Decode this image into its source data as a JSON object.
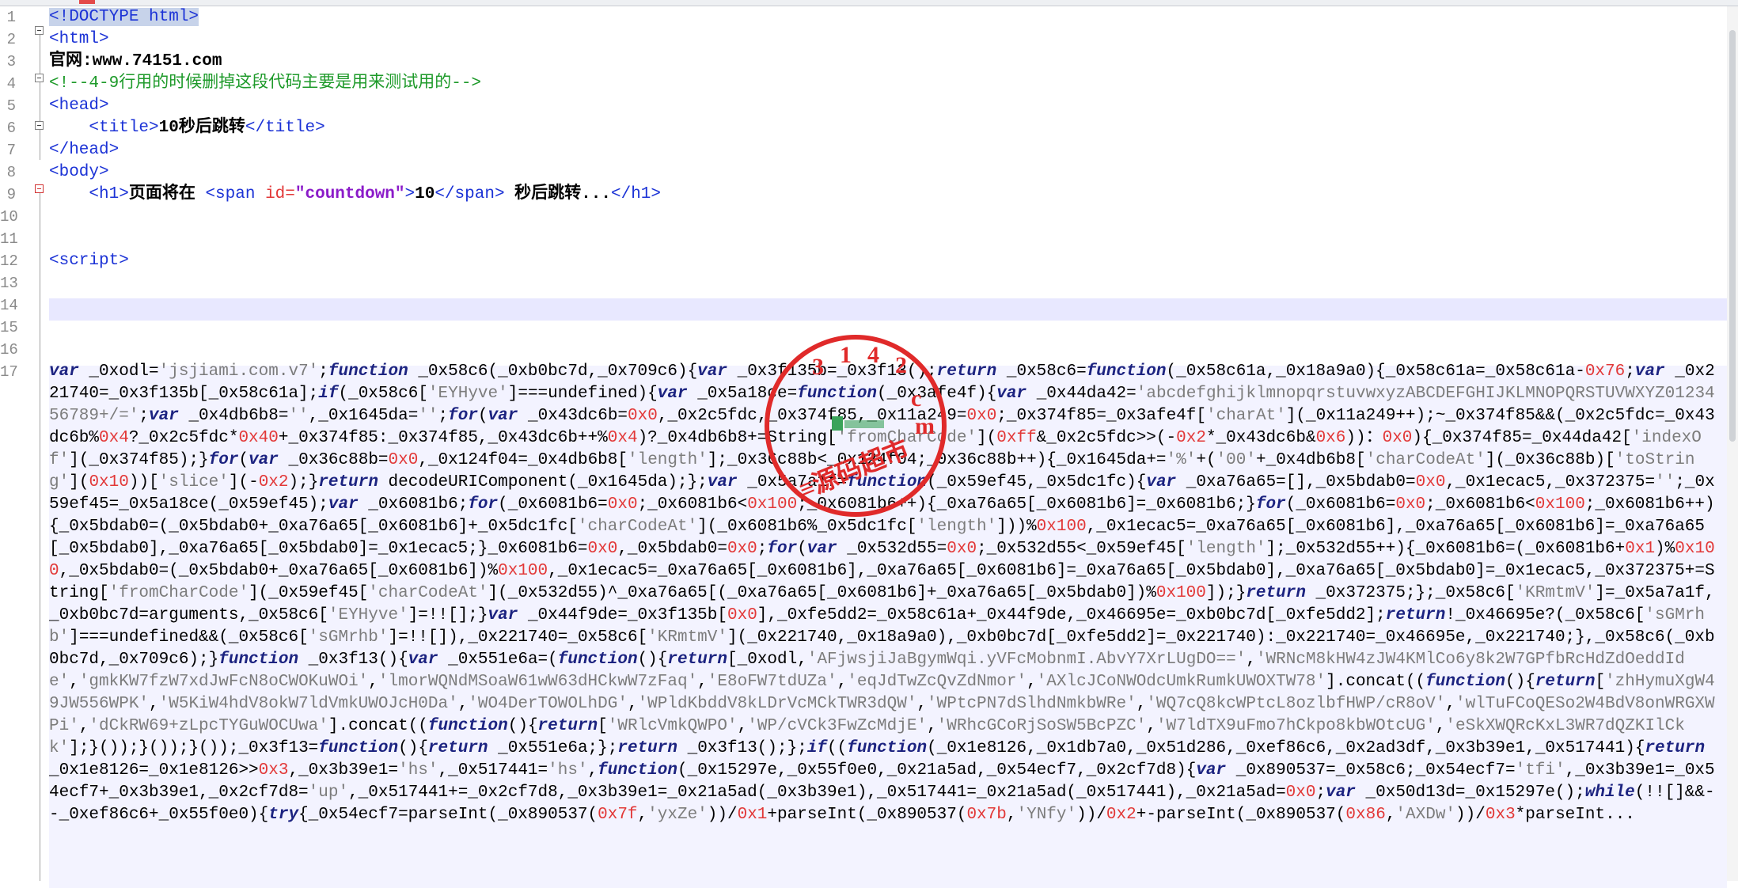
{
  "editor": {
    "line_numbers": [
      "1",
      "2",
      "3",
      "4",
      "5",
      "6",
      "7",
      "8",
      "9",
      "10",
      "11",
      "12",
      "13",
      "14",
      "15",
      "16",
      "17"
    ],
    "lines": {
      "l1": "<!DOCTYPE html>",
      "l2": "<html>",
      "l3": "官网:www.74151.com",
      "l4": "<!--4-9行用的时候删掉这段代码主要是用来测试用的-->",
      "l5": "<head>",
      "l6a": "<title>",
      "l6b": "10秒后跳转",
      "l6c": "</title>",
      "l7": "</head>",
      "l8": "<body>",
      "l9a": "<h1>",
      "l9b": "页面将在 ",
      "l9c": "<span ",
      "l9d": "id=",
      "l9e": "\"countdown\"",
      "l9f": ">",
      "l9g": "10",
      "l9h": "</span>",
      "l9i": " 秒后跳转...",
      "l9j": "</h1>",
      "l12": "<script>"
    },
    "code_17": [
      [
        "kw",
        "var "
      ],
      [
        "p",
        "_0xodl="
      ],
      [
        "str",
        "'jsjiami.com.v7'"
      ],
      [
        "p",
        ";"
      ],
      [
        "kw",
        "function "
      ],
      [
        "p",
        "_0x58c6(_0xb0bc7d,_0x709c6){"
      ],
      [
        "kw",
        "var "
      ],
      [
        "p",
        "_0x3f135b=_0x3f13();"
      ],
      [
        "kw",
        "return "
      ],
      [
        "p",
        "_0x58c6="
      ],
      [
        "kw",
        "function"
      ],
      [
        "p",
        "(_0x58c61a,_0x18a9a0){_0x58c61a=_0x58c61a-"
      ],
      [
        "num",
        "0x76"
      ],
      [
        "p",
        ";"
      ],
      [
        "kw",
        "var "
      ],
      [
        "p",
        "_0x221740=_0x3f135b[_0x58c61a];"
      ],
      [
        "kw",
        "if"
      ],
      [
        "p",
        "(_0x58c6["
      ],
      [
        "str",
        "'EYHyve'"
      ],
      [
        "p",
        "]===undefined){"
      ],
      [
        "kw",
        "var "
      ],
      [
        "p",
        "_0x5a18ce="
      ],
      [
        "kw",
        "function"
      ],
      [
        "p",
        "(_0x3afe4f){"
      ],
      [
        "kw",
        "var "
      ],
      [
        "p",
        "_0x44da42="
      ],
      [
        "str",
        "'abcdefghijklmnopqrstuvwxyzABCDEFGHIJKLMNOPQRSTUVWXYZ0123456789+/='"
      ],
      [
        "p",
        ";"
      ],
      [
        "kw",
        "var "
      ],
      [
        "p",
        "_0x4db6b8="
      ],
      [
        "str",
        "''"
      ],
      [
        "p",
        ",_0x1645da="
      ],
      [
        "str",
        "''"
      ],
      [
        "p",
        ";"
      ],
      [
        "kw",
        "for"
      ],
      [
        "p",
        "("
      ],
      [
        "kw",
        "var "
      ],
      [
        "p",
        "_0x43dc6b="
      ],
      [
        "num",
        "0x0"
      ],
      [
        "p",
        ",_0x2c5fdc,_0x374f85,_0x11a249="
      ],
      [
        "num",
        "0x0"
      ],
      [
        "p",
        ";_0x374f85=_0x3afe4f["
      ],
      [
        "str",
        "'charAt'"
      ],
      [
        "p",
        "](_0x11a249++);~_0x374f85&&(_0x2c5fdc=_0x43dc6b%"
      ],
      [
        "num",
        "0x4"
      ],
      [
        "p",
        "?_0x2c5fdc*"
      ],
      [
        "num",
        "0x40"
      ],
      [
        "p",
        "+_0x374f85:_0x374f85,_0x43dc6b++%"
      ],
      [
        "num",
        "0x4"
      ],
      [
        "p",
        ")?_0x4db6b8+=String["
      ],
      [
        "str",
        "'fromCharCode'"
      ],
      [
        "p",
        "]("
      ],
      [
        "num",
        "0xff"
      ],
      [
        "p",
        "&_0x2c5fdc>>(-"
      ],
      [
        "num",
        "0x2"
      ],
      [
        "p",
        "*_0x43dc6b&"
      ],
      [
        "num",
        "0x6"
      ],
      [
        "p",
        "))："
      ],
      [
        "num",
        "0x0"
      ],
      [
        "p",
        "){_0x374f85=_0x44da42["
      ],
      [
        "str",
        "'indexOf'"
      ],
      [
        "p",
        "](_0x374f85);}"
      ],
      [
        "kw",
        "for"
      ],
      [
        "p",
        "("
      ],
      [
        "kw",
        "var "
      ],
      [
        "p",
        "_0x36c88b="
      ],
      [
        "num",
        "0x0"
      ],
      [
        "p",
        ",_0x124f04=_0x4db6b8["
      ],
      [
        "str",
        "'length'"
      ],
      [
        "p",
        "];_0x36c88b<_0x124f04;_0x36c88b++){_0x1645da+="
      ],
      [
        "str",
        "'%'"
      ],
      [
        "p",
        "+("
      ],
      [
        "str",
        "'00'"
      ],
      [
        "p",
        "+_0x4db6b8["
      ],
      [
        "str",
        "'charCodeAt'"
      ],
      [
        "p",
        "](_0x36c88b)["
      ],
      [
        "str",
        "'toString'"
      ],
      [
        "p",
        "]("
      ],
      [
        "num",
        "0x10"
      ],
      [
        "p",
        "))["
      ],
      [
        "str",
        "'slice'"
      ],
      [
        "p",
        "](-"
      ],
      [
        "num",
        "0x2"
      ],
      [
        "p",
        ");}"
      ],
      [
        "kw",
        "return "
      ],
      [
        "p",
        "decodeURIComponent(_0x1645da);};"
      ],
      [
        "kw",
        "var "
      ],
      [
        "p",
        "_0x5a7a1f="
      ],
      [
        "kw",
        "function"
      ],
      [
        "p",
        "(_0x59ef45,_0x5dc1fc){"
      ],
      [
        "kw",
        "var "
      ],
      [
        "p",
        "_0xa76a65=[],_0x5bdab0="
      ],
      [
        "num",
        "0x0"
      ],
      [
        "p",
        ",_0x1ecac5,_0x372375="
      ],
      [
        "str",
        "''"
      ],
      [
        "p",
        ";_0x59ef45=_0x5a18ce(_0x59ef45);"
      ],
      [
        "kw",
        "var "
      ],
      [
        "p",
        "_0x6081b6;"
      ],
      [
        "kw",
        "for"
      ],
      [
        "p",
        "(_0x6081b6="
      ],
      [
        "num",
        "0x0"
      ],
      [
        "p",
        ";_0x6081b6<"
      ],
      [
        "num",
        "0x100"
      ],
      [
        "p",
        ";_0x6081b6++){_0xa76a65[_0x6081b6]=_0x6081b6;}"
      ],
      [
        "kw",
        "for"
      ],
      [
        "p",
        "(_0x6081b6="
      ],
      [
        "num",
        "0x0"
      ],
      [
        "p",
        ";_0x6081b6<"
      ],
      [
        "num",
        "0x100"
      ],
      [
        "p",
        ";_0x6081b6++){_0x5bdab0=(_0x5bdab0+_0xa76a65[_0x6081b6]+_0x5dc1fc["
      ],
      [
        "str",
        "'charCodeAt'"
      ],
      [
        "p",
        "](_0x6081b6%_0x5dc1fc["
      ],
      [
        "str",
        "'length'"
      ],
      [
        "p",
        "]))%"
      ],
      [
        "num",
        "0x100"
      ],
      [
        "p",
        ",_0x1ecac5=_0xa76a65[_0x6081b6],_0xa76a65[_0x6081b6]=_0xa76a65[_0x5bdab0],_0xa76a65[_0x5bdab0]=_0x1ecac5;}_0x6081b6="
      ],
      [
        "num",
        "0x0"
      ],
      [
        "p",
        ",_0x5bdab0="
      ],
      [
        "num",
        "0x0"
      ],
      [
        "p",
        ";"
      ],
      [
        "kw",
        "for"
      ],
      [
        "p",
        "("
      ],
      [
        "kw",
        "var "
      ],
      [
        "p",
        "_0x532d55="
      ],
      [
        "num",
        "0x0"
      ],
      [
        "p",
        ";_0x532d55<_0x59ef45["
      ],
      [
        "str",
        "'length'"
      ],
      [
        "p",
        "];_0x532d55++){_0x6081b6=(_0x6081b6+"
      ],
      [
        "num",
        "0x1"
      ],
      [
        "p",
        ")%"
      ],
      [
        "num",
        "0x100"
      ],
      [
        "p",
        ",_0x5bdab0=(_0x5bdab0+_0xa76a65[_0x6081b6])%"
      ],
      [
        "num",
        "0x100"
      ],
      [
        "p",
        ",_0x1ecac5=_0xa76a65[_0x6081b6],_0xa76a65[_0x6081b6]=_0xa76a65[_0x5bdab0],_0xa76a65[_0x5bdab0]=_0x1ecac5,_0x372375+=String["
      ],
      [
        "str",
        "'fromCharCode'"
      ],
      [
        "p",
        "](_0x59ef45["
      ],
      [
        "str",
        "'charCodeAt'"
      ],
      [
        "p",
        "](_0x532d55)^_0xa76a65[(_0xa76a65[_0x6081b6]+_0xa76a65[_0x5bdab0])%"
      ],
      [
        "num",
        "0x100"
      ],
      [
        "p",
        "]);}"
      ],
      [
        "kw",
        "return "
      ],
      [
        "p",
        "_0x372375;};_0x58c6["
      ],
      [
        "str",
        "'KRmtmV'"
      ],
      [
        "p",
        "]=_0x5a7a1f,_0xb0bc7d=arguments,_0x58c6["
      ],
      [
        "str",
        "'EYHyve'"
      ],
      [
        "p",
        "]=!![];}"
      ],
      [
        "kw",
        "var "
      ],
      [
        "p",
        "_0x44f9de=_0x3f135b["
      ],
      [
        "num",
        "0x0"
      ],
      [
        "p",
        "],_0xfe5dd2=_0x58c61a+_0x44f9de,_0x46695e=_0xb0bc7d[_0xfe5dd2];"
      ],
      [
        "kw",
        "return"
      ],
      [
        "p",
        "!_0x46695e?(_0x58c6["
      ],
      [
        "str",
        "'sGMrhb'"
      ],
      [
        "p",
        "]===undefined&&(_0x58c6["
      ],
      [
        "str",
        "'sGMrhb'"
      ],
      [
        "p",
        "]=!![]),_0x221740=_0x58c6["
      ],
      [
        "str",
        "'KRmtmV'"
      ],
      [
        "p",
        "](_0x221740,_0x18a9a0),_0xb0bc7d[_0xfe5dd2]=_0x221740):_0x221740=_0x46695e,_0x221740;},_0x58c6(_0xb0bc7d,_0x709c6);}"
      ],
      [
        "kw",
        "function "
      ],
      [
        "p",
        "_0x3f13(){"
      ],
      [
        "kw",
        "var "
      ],
      [
        "p",
        "_0x551e6a=("
      ],
      [
        "kw",
        "function"
      ],
      [
        "p",
        "(){"
      ],
      [
        "kw",
        "return"
      ],
      [
        "p",
        "[_0xodl,"
      ],
      [
        "str",
        "'AFjwsjiJaBgymWqi.yVFcMobnmI.AbvY7XrLUgDO=='"
      ],
      [
        "p",
        ","
      ],
      [
        "str",
        "'WRNcM8kHW4zJW4KMlCo6y8k2W7GPfbRcHdZdOeddIde'"
      ],
      [
        "p",
        ","
      ],
      [
        "str",
        "'gmkKW7fzW7xdJwFcN8oCWOKuWOi'"
      ],
      [
        "p",
        ","
      ],
      [
        "str",
        "'lmorWQNdMSoaW61wW63dHCkwW7zFaq'"
      ],
      [
        "p",
        ","
      ],
      [
        "str",
        "'E8oFW7tdUZa'"
      ],
      [
        "p",
        ","
      ],
      [
        "str",
        "'eqJdTwZcQvZdNmor'"
      ],
      [
        "p",
        ","
      ],
      [
        "str",
        "'AXlcJCoNWOdcUmkRumkUWOXTW78'"
      ],
      [
        "p",
        "].concat(("
      ],
      [
        "kw",
        "function"
      ],
      [
        "p",
        "(){"
      ],
      [
        "kw",
        "return"
      ],
      [
        "p",
        "["
      ],
      [
        "str",
        "'zhHymuXgW49JW556WPK'"
      ],
      [
        "p",
        ","
      ],
      [
        "str",
        "'W5KiW4hdV8okW7ldVmkUWOJcH0Da'"
      ],
      [
        "p",
        ","
      ],
      [
        "str",
        "'WO4DerTOWOLhDG'"
      ],
      [
        "p",
        ","
      ],
      [
        "str",
        "'WPldKbddV8kLDrVcMCkTWR3dQW'"
      ],
      [
        "p",
        ","
      ],
      [
        "str",
        "'WPtcPN7dSlhdNmkbWRe'"
      ],
      [
        "p",
        ","
      ],
      [
        "str",
        "'WQ7cQ8kcWPtcL8ozlbfHWP/cR8oV'"
      ],
      [
        "p",
        ","
      ],
      [
        "str",
        "'wlTuFCoQESo2W4BdV8onWRGXWPi'"
      ],
      [
        "p",
        ","
      ],
      [
        "str",
        "'dCkRW69+zLpcTYGuWOCUwa'"
      ],
      [
        "p",
        "].concat(("
      ],
      [
        "kw",
        "function"
      ],
      [
        "p",
        "(){"
      ],
      [
        "kw",
        "return"
      ],
      [
        "p",
        "["
      ],
      [
        "str",
        "'WRlcVmkQWPO'"
      ],
      [
        "p",
        ","
      ],
      [
        "str",
        "'WP/cVCk3FwZcMdjE'"
      ],
      [
        "p",
        ","
      ],
      [
        "str",
        "'WRhcGCoRjSoSW5BcPZC'"
      ],
      [
        "p",
        ","
      ],
      [
        "str",
        "'W7ldTX9uFmo7hCkpo8kbWOtcUG'"
      ],
      [
        "p",
        ","
      ],
      [
        "str",
        "'eSkXWQRcKxL3WR7dQZKIlCkk'"
      ],
      [
        "p",
        "];}());}());}());_0x3f13="
      ],
      [
        "kw",
        "function"
      ],
      [
        "p",
        "(){"
      ],
      [
        "kw",
        "return "
      ],
      [
        "p",
        "_0x551e6a;};"
      ],
      [
        "kw",
        "return "
      ],
      [
        "p",
        "_0x3f13();};"
      ],
      [
        "kw",
        "if"
      ],
      [
        "p",
        "(("
      ],
      [
        "kw",
        "function"
      ],
      [
        "p",
        "(_0x1e8126,_0x1db7a0,_0x51d286,_0xef86c6,_0x2ad3df,_0x3b39e1,_0x517441){"
      ],
      [
        "kw",
        "return "
      ],
      [
        "p",
        "_0x1e8126=_0x1e8126>>"
      ],
      [
        "num",
        "0x3"
      ],
      [
        "p",
        ",_0x3b39e1="
      ],
      [
        "str",
        "'hs'"
      ],
      [
        "p",
        ",_0x517441="
      ],
      [
        "str",
        "'hs'"
      ],
      [
        "p",
        ","
      ],
      [
        "kw",
        "function"
      ],
      [
        "p",
        "(_0x15297e,_0x55f0e0,_0x21a5ad,_0x54ecf7,_0x2cf7d8){"
      ],
      [
        "kw",
        "var "
      ],
      [
        "p",
        "_0x890537=_0x58c6;_0x54ecf7="
      ],
      [
        "str",
        "'tfi'"
      ],
      [
        "p",
        ",_0x3b39e1=_0x54ecf7+_0x3b39e1,_0x2cf7d8="
      ],
      [
        "str",
        "'up'"
      ],
      [
        "p",
        ",_0x517441+=_0x2cf7d8,_0x3b39e1=_0x21a5ad(_0x3b39e1),_0x517441=_0x21a5ad(_0x517441),_0x21a5ad="
      ],
      [
        "num",
        "0x0"
      ],
      [
        "p",
        ";"
      ],
      [
        "kw",
        "var "
      ],
      [
        "p",
        "_0x50d13d=_0x15297e();"
      ],
      [
        "kw",
        "while"
      ],
      [
        "p",
        "(!![]&&--_0xef86c6+_0x55f0e0){"
      ],
      [
        "kw",
        "try"
      ],
      [
        "p",
        "{_0x54ecf7=parseInt(_0x890537("
      ],
      [
        "num",
        "0x7f"
      ],
      [
        "p",
        ","
      ],
      [
        "str",
        "'yxZe'"
      ],
      [
        "p",
        "))/"
      ],
      [
        "num",
        "0x1"
      ],
      [
        "p",
        "+parseInt(_0x890537("
      ],
      [
        "num",
        "0x7b"
      ],
      [
        "p",
        ","
      ],
      [
        "str",
        "'YNfy'"
      ],
      [
        "p",
        "))/"
      ],
      [
        "num",
        "0x2"
      ],
      [
        "p",
        "+-parseInt(_0x890537("
      ],
      [
        "num",
        "0x86"
      ],
      [
        "p",
        ","
      ],
      [
        "str",
        "'AXDw'"
      ],
      [
        "p",
        "))/"
      ],
      [
        "num",
        "0x3"
      ],
      [
        "p",
        "*parseInt..."
      ]
    ]
  },
  "stamp": {
    "ring_text": [
      "3",
      "1",
      "4",
      "2",
      "c",
      "m"
    ],
    "inner_text": "≡源码超市",
    "color": "#e02a2a"
  }
}
